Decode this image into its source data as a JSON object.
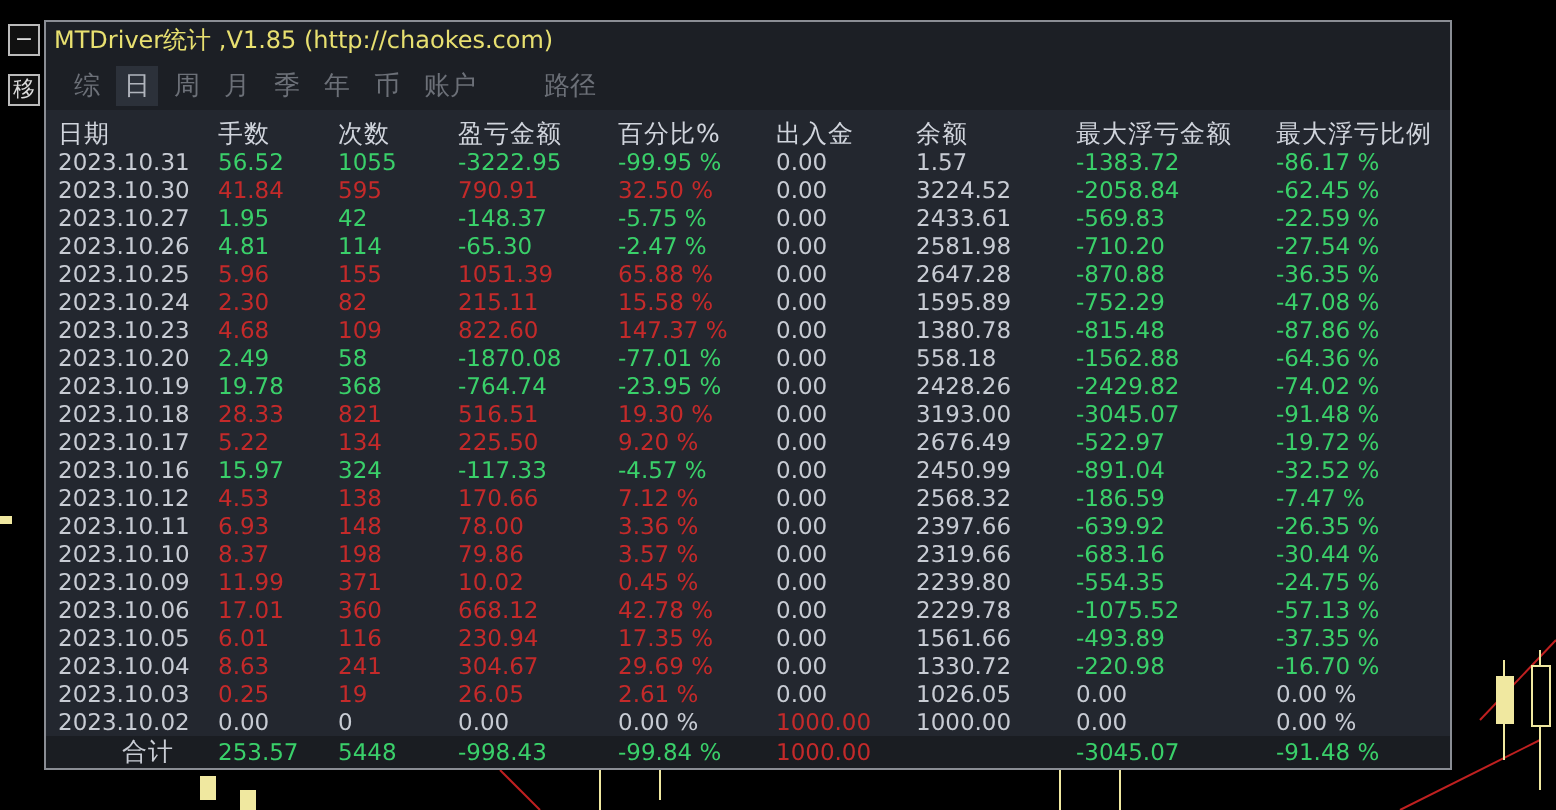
{
  "side_buttons": [
    {
      "label": "−"
    },
    {
      "label": "移"
    }
  ],
  "window": {
    "title": "MTDriver统计 ,V1.85 (http://chaokes.com)"
  },
  "tabs": [
    {
      "label": "综",
      "selected": false
    },
    {
      "label": "日",
      "selected": true
    },
    {
      "label": "周",
      "selected": false
    },
    {
      "label": "月",
      "selected": false
    },
    {
      "label": "季",
      "selected": false
    },
    {
      "label": "年",
      "selected": false
    },
    {
      "label": "币",
      "selected": false
    },
    {
      "label": "账户",
      "selected": false
    },
    {
      "label": "路径",
      "selected": false
    }
  ],
  "table": {
    "columns": [
      "日期",
      "手数",
      "次数",
      "盈亏金额",
      "百分比%",
      "出入金",
      "余额",
      "最大浮亏金额",
      "最大浮亏比例"
    ],
    "rows": [
      {
        "cells": [
          {
            "text": "2023.10.31",
            "color": "#c8ccd4"
          },
          {
            "text": "56.52",
            "color": "#3ad06a"
          },
          {
            "text": "1055",
            "color": "#3ad06a"
          },
          {
            "text": "-3222.95",
            "color": "#3ad06a"
          },
          {
            "text": "-99.95 %",
            "color": "#3ad06a"
          },
          {
            "text": "0.00",
            "color": "#c8ccd4"
          },
          {
            "text": "1.57",
            "color": "#c8ccd4"
          },
          {
            "text": "-1383.72",
            "color": "#3ad06a"
          },
          {
            "text": "-86.17 %",
            "color": "#3ad06a"
          }
        ]
      },
      {
        "cells": [
          {
            "text": "2023.10.30",
            "color": "#c8ccd4"
          },
          {
            "text": "41.84",
            "color": "#c42a2a"
          },
          {
            "text": "595",
            "color": "#c42a2a"
          },
          {
            "text": "790.91",
            "color": "#c42a2a"
          },
          {
            "text": "32.50 %",
            "color": "#c42a2a"
          },
          {
            "text": "0.00",
            "color": "#c8ccd4"
          },
          {
            "text": "3224.52",
            "color": "#c8ccd4"
          },
          {
            "text": "-2058.84",
            "color": "#3ad06a"
          },
          {
            "text": "-62.45 %",
            "color": "#3ad06a"
          }
        ]
      },
      {
        "cells": [
          {
            "text": "2023.10.27",
            "color": "#c8ccd4"
          },
          {
            "text": "1.95",
            "color": "#3ad06a"
          },
          {
            "text": "42",
            "color": "#3ad06a"
          },
          {
            "text": "-148.37",
            "color": "#3ad06a"
          },
          {
            "text": "-5.75 %",
            "color": "#3ad06a"
          },
          {
            "text": "0.00",
            "color": "#c8ccd4"
          },
          {
            "text": "2433.61",
            "color": "#c8ccd4"
          },
          {
            "text": "-569.83",
            "color": "#3ad06a"
          },
          {
            "text": "-22.59 %",
            "color": "#3ad06a"
          }
        ]
      },
      {
        "cells": [
          {
            "text": "2023.10.26",
            "color": "#c8ccd4"
          },
          {
            "text": "4.81",
            "color": "#3ad06a"
          },
          {
            "text": "114",
            "color": "#3ad06a"
          },
          {
            "text": "-65.30",
            "color": "#3ad06a"
          },
          {
            "text": "-2.47 %",
            "color": "#3ad06a"
          },
          {
            "text": "0.00",
            "color": "#c8ccd4"
          },
          {
            "text": "2581.98",
            "color": "#c8ccd4"
          },
          {
            "text": "-710.20",
            "color": "#3ad06a"
          },
          {
            "text": "-27.54 %",
            "color": "#3ad06a"
          }
        ]
      },
      {
        "cells": [
          {
            "text": "2023.10.25",
            "color": "#c8ccd4"
          },
          {
            "text": "5.96",
            "color": "#c42a2a"
          },
          {
            "text": "155",
            "color": "#c42a2a"
          },
          {
            "text": "1051.39",
            "color": "#c42a2a"
          },
          {
            "text": "65.88 %",
            "color": "#c42a2a"
          },
          {
            "text": "0.00",
            "color": "#c8ccd4"
          },
          {
            "text": "2647.28",
            "color": "#c8ccd4"
          },
          {
            "text": "-870.88",
            "color": "#3ad06a"
          },
          {
            "text": "-36.35 %",
            "color": "#3ad06a"
          }
        ]
      },
      {
        "cells": [
          {
            "text": "2023.10.24",
            "color": "#c8ccd4"
          },
          {
            "text": "2.30",
            "color": "#c42a2a"
          },
          {
            "text": "82",
            "color": "#c42a2a"
          },
          {
            "text": "215.11",
            "color": "#c42a2a"
          },
          {
            "text": "15.58 %",
            "color": "#c42a2a"
          },
          {
            "text": "0.00",
            "color": "#c8ccd4"
          },
          {
            "text": "1595.89",
            "color": "#c8ccd4"
          },
          {
            "text": "-752.29",
            "color": "#3ad06a"
          },
          {
            "text": "-47.08 %",
            "color": "#3ad06a"
          }
        ]
      },
      {
        "cells": [
          {
            "text": "2023.10.23",
            "color": "#c8ccd4"
          },
          {
            "text": "4.68",
            "color": "#c42a2a"
          },
          {
            "text": "109",
            "color": "#c42a2a"
          },
          {
            "text": "822.60",
            "color": "#c42a2a"
          },
          {
            "text": "147.37 %",
            "color": "#c42a2a"
          },
          {
            "text": "0.00",
            "color": "#c8ccd4"
          },
          {
            "text": "1380.78",
            "color": "#c8ccd4"
          },
          {
            "text": "-815.48",
            "color": "#3ad06a"
          },
          {
            "text": "-87.86 %",
            "color": "#3ad06a"
          }
        ]
      },
      {
        "cells": [
          {
            "text": "2023.10.20",
            "color": "#c8ccd4"
          },
          {
            "text": "2.49",
            "color": "#3ad06a"
          },
          {
            "text": "58",
            "color": "#3ad06a"
          },
          {
            "text": "-1870.08",
            "color": "#3ad06a"
          },
          {
            "text": "-77.01 %",
            "color": "#3ad06a"
          },
          {
            "text": "0.00",
            "color": "#c8ccd4"
          },
          {
            "text": "558.18",
            "color": "#c8ccd4"
          },
          {
            "text": "-1562.88",
            "color": "#3ad06a"
          },
          {
            "text": "-64.36 %",
            "color": "#3ad06a"
          }
        ]
      },
      {
        "cells": [
          {
            "text": "2023.10.19",
            "color": "#c8ccd4"
          },
          {
            "text": "19.78",
            "color": "#3ad06a"
          },
          {
            "text": "368",
            "color": "#3ad06a"
          },
          {
            "text": "-764.74",
            "color": "#3ad06a"
          },
          {
            "text": "-23.95 %",
            "color": "#3ad06a"
          },
          {
            "text": "0.00",
            "color": "#c8ccd4"
          },
          {
            "text": "2428.26",
            "color": "#c8ccd4"
          },
          {
            "text": "-2429.82",
            "color": "#3ad06a"
          },
          {
            "text": "-74.02 %",
            "color": "#3ad06a"
          }
        ]
      },
      {
        "cells": [
          {
            "text": "2023.10.18",
            "color": "#c8ccd4"
          },
          {
            "text": "28.33",
            "color": "#c42a2a"
          },
          {
            "text": "821",
            "color": "#c42a2a"
          },
          {
            "text": "516.51",
            "color": "#c42a2a"
          },
          {
            "text": "19.30 %",
            "color": "#c42a2a"
          },
          {
            "text": "0.00",
            "color": "#c8ccd4"
          },
          {
            "text": "3193.00",
            "color": "#c8ccd4"
          },
          {
            "text": "-3045.07",
            "color": "#3ad06a"
          },
          {
            "text": "-91.48 %",
            "color": "#3ad06a"
          }
        ]
      },
      {
        "cells": [
          {
            "text": "2023.10.17",
            "color": "#c8ccd4"
          },
          {
            "text": "5.22",
            "color": "#c42a2a"
          },
          {
            "text": "134",
            "color": "#c42a2a"
          },
          {
            "text": "225.50",
            "color": "#c42a2a"
          },
          {
            "text": "9.20 %",
            "color": "#c42a2a"
          },
          {
            "text": "0.00",
            "color": "#c8ccd4"
          },
          {
            "text": "2676.49",
            "color": "#c8ccd4"
          },
          {
            "text": "-522.97",
            "color": "#3ad06a"
          },
          {
            "text": "-19.72 %",
            "color": "#3ad06a"
          }
        ]
      },
      {
        "cells": [
          {
            "text": "2023.10.16",
            "color": "#c8ccd4"
          },
          {
            "text": "15.97",
            "color": "#3ad06a"
          },
          {
            "text": "324",
            "color": "#3ad06a"
          },
          {
            "text": "-117.33",
            "color": "#3ad06a"
          },
          {
            "text": "-4.57 %",
            "color": "#3ad06a"
          },
          {
            "text": "0.00",
            "color": "#c8ccd4"
          },
          {
            "text": "2450.99",
            "color": "#c8ccd4"
          },
          {
            "text": "-891.04",
            "color": "#3ad06a"
          },
          {
            "text": "-32.52 %",
            "color": "#3ad06a"
          }
        ]
      },
      {
        "cells": [
          {
            "text": "2023.10.12",
            "color": "#c8ccd4"
          },
          {
            "text": "4.53",
            "color": "#c42a2a"
          },
          {
            "text": "138",
            "color": "#c42a2a"
          },
          {
            "text": "170.66",
            "color": "#c42a2a"
          },
          {
            "text": "7.12 %",
            "color": "#c42a2a"
          },
          {
            "text": "0.00",
            "color": "#c8ccd4"
          },
          {
            "text": "2568.32",
            "color": "#c8ccd4"
          },
          {
            "text": "-186.59",
            "color": "#3ad06a"
          },
          {
            "text": "-7.47 %",
            "color": "#3ad06a"
          }
        ]
      },
      {
        "cells": [
          {
            "text": "2023.10.11",
            "color": "#c8ccd4"
          },
          {
            "text": "6.93",
            "color": "#c42a2a"
          },
          {
            "text": "148",
            "color": "#c42a2a"
          },
          {
            "text": "78.00",
            "color": "#c42a2a"
          },
          {
            "text": "3.36 %",
            "color": "#c42a2a"
          },
          {
            "text": "0.00",
            "color": "#c8ccd4"
          },
          {
            "text": "2397.66",
            "color": "#c8ccd4"
          },
          {
            "text": "-639.92",
            "color": "#3ad06a"
          },
          {
            "text": "-26.35 %",
            "color": "#3ad06a"
          }
        ]
      },
      {
        "cells": [
          {
            "text": "2023.10.10",
            "color": "#c8ccd4"
          },
          {
            "text": "8.37",
            "color": "#c42a2a"
          },
          {
            "text": "198",
            "color": "#c42a2a"
          },
          {
            "text": "79.86",
            "color": "#c42a2a"
          },
          {
            "text": "3.57 %",
            "color": "#c42a2a"
          },
          {
            "text": "0.00",
            "color": "#c8ccd4"
          },
          {
            "text": "2319.66",
            "color": "#c8ccd4"
          },
          {
            "text": "-683.16",
            "color": "#3ad06a"
          },
          {
            "text": "-30.44 %",
            "color": "#3ad06a"
          }
        ]
      },
      {
        "cells": [
          {
            "text": "2023.10.09",
            "color": "#c8ccd4"
          },
          {
            "text": "11.99",
            "color": "#c42a2a"
          },
          {
            "text": "371",
            "color": "#c42a2a"
          },
          {
            "text": "10.02",
            "color": "#c42a2a"
          },
          {
            "text": "0.45 %",
            "color": "#c42a2a"
          },
          {
            "text": "0.00",
            "color": "#c8ccd4"
          },
          {
            "text": "2239.80",
            "color": "#c8ccd4"
          },
          {
            "text": "-554.35",
            "color": "#3ad06a"
          },
          {
            "text": "-24.75 %",
            "color": "#3ad06a"
          }
        ]
      },
      {
        "cells": [
          {
            "text": "2023.10.06",
            "color": "#c8ccd4"
          },
          {
            "text": "17.01",
            "color": "#c42a2a"
          },
          {
            "text": "360",
            "color": "#c42a2a"
          },
          {
            "text": "668.12",
            "color": "#c42a2a"
          },
          {
            "text": "42.78 %",
            "color": "#c42a2a"
          },
          {
            "text": "0.00",
            "color": "#c8ccd4"
          },
          {
            "text": "2229.78",
            "color": "#c8ccd4"
          },
          {
            "text": "-1075.52",
            "color": "#3ad06a"
          },
          {
            "text": "-57.13 %",
            "color": "#3ad06a"
          }
        ]
      },
      {
        "cells": [
          {
            "text": "2023.10.05",
            "color": "#c8ccd4"
          },
          {
            "text": "6.01",
            "color": "#c42a2a"
          },
          {
            "text": "116",
            "color": "#c42a2a"
          },
          {
            "text": "230.94",
            "color": "#c42a2a"
          },
          {
            "text": "17.35 %",
            "color": "#c42a2a"
          },
          {
            "text": "0.00",
            "color": "#c8ccd4"
          },
          {
            "text": "1561.66",
            "color": "#c8ccd4"
          },
          {
            "text": "-493.89",
            "color": "#3ad06a"
          },
          {
            "text": "-37.35 %",
            "color": "#3ad06a"
          }
        ]
      },
      {
        "cells": [
          {
            "text": "2023.10.04",
            "color": "#c8ccd4"
          },
          {
            "text": "8.63",
            "color": "#c42a2a"
          },
          {
            "text": "241",
            "color": "#c42a2a"
          },
          {
            "text": "304.67",
            "color": "#c42a2a"
          },
          {
            "text": "29.69 %",
            "color": "#c42a2a"
          },
          {
            "text": "0.00",
            "color": "#c8ccd4"
          },
          {
            "text": "1330.72",
            "color": "#c8ccd4"
          },
          {
            "text": "-220.98",
            "color": "#3ad06a"
          },
          {
            "text": "-16.70 %",
            "color": "#3ad06a"
          }
        ]
      },
      {
        "cells": [
          {
            "text": "2023.10.03",
            "color": "#c8ccd4"
          },
          {
            "text": "0.25",
            "color": "#c42a2a"
          },
          {
            "text": "19",
            "color": "#c42a2a"
          },
          {
            "text": "26.05",
            "color": "#c42a2a"
          },
          {
            "text": "2.61 %",
            "color": "#c42a2a"
          },
          {
            "text": "0.00",
            "color": "#c8ccd4"
          },
          {
            "text": "1026.05",
            "color": "#c8ccd4"
          },
          {
            "text": "0.00",
            "color": "#c8ccd4"
          },
          {
            "text": "0.00 %",
            "color": "#c8ccd4"
          }
        ]
      },
      {
        "cells": [
          {
            "text": "2023.10.02",
            "color": "#c8ccd4"
          },
          {
            "text": "0.00",
            "color": "#c8ccd4"
          },
          {
            "text": "0",
            "color": "#c8ccd4"
          },
          {
            "text": "0.00",
            "color": "#c8ccd4"
          },
          {
            "text": "0.00 %",
            "color": "#c8ccd4"
          },
          {
            "text": "1000.00",
            "color": "#c42a2a"
          },
          {
            "text": "1000.00",
            "color": "#c8ccd4"
          },
          {
            "text": "0.00",
            "color": "#c8ccd4"
          },
          {
            "text": "0.00 %",
            "color": "#c8ccd4"
          }
        ]
      }
    ],
    "totals": {
      "cells": [
        {
          "text": "合计",
          "color": "#c8ccd4"
        },
        {
          "text": "253.57",
          "color": "#3ad06a"
        },
        {
          "text": "5448",
          "color": "#3ad06a"
        },
        {
          "text": "-998.43",
          "color": "#3ad06a"
        },
        {
          "text": "-99.84 %",
          "color": "#3ad06a"
        },
        {
          "text": "1000.00",
          "color": "#c42a2a"
        },
        null,
        {
          "text": "-3045.07",
          "color": "#3ad06a"
        },
        {
          "text": "-91.48 %",
          "color": "#3ad06a"
        }
      ]
    }
  }
}
